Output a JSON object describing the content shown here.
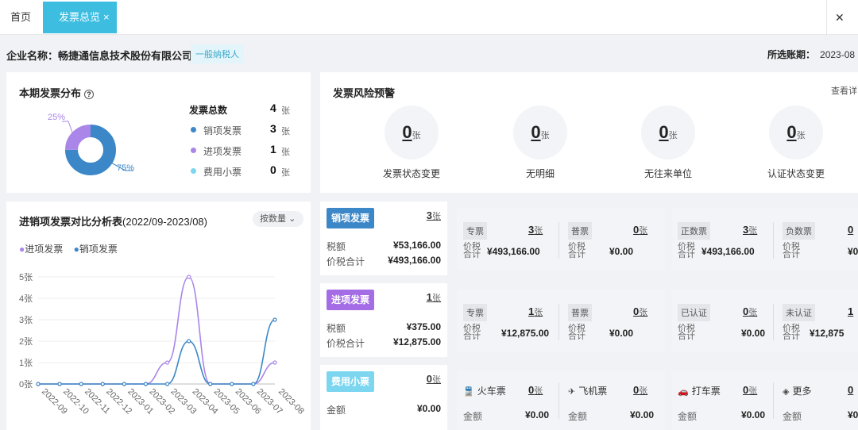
{
  "tabs": {
    "home": "首页",
    "active": "发票总览",
    "active_close": "×",
    "close_all": "✕"
  },
  "company": {
    "label": "企业名称：畅捷通信息技术股份有限公司",
    "tax_type": "一般纳税人"
  },
  "period": {
    "label": "所选账期：",
    "value": "2023-08"
  },
  "distribution": {
    "title": "本期发票分布",
    "help": "?",
    "pct_sales": "75%",
    "pct_purchase": "25%",
    "total_label": "发票总数",
    "total": "4",
    "unit": "张",
    "items": [
      {
        "label": "销项发票",
        "count": "3",
        "color": "#3c87c7"
      },
      {
        "label": "进项发票",
        "count": "1",
        "color": "#a986e8"
      },
      {
        "label": "费用小票",
        "count": "0",
        "color": "#7dd6f0"
      }
    ]
  },
  "risk": {
    "title": "发票风险预警",
    "link": "查看详",
    "unit": "张",
    "items": [
      {
        "label": "发票状态变更",
        "count": "0"
      },
      {
        "label": "无明细",
        "count": "0"
      },
      {
        "label": "无往来单位",
        "count": "0"
      },
      {
        "label": "认证状态变更",
        "count": "0"
      }
    ]
  },
  "compare": {
    "title": "进销项发票对比分析表",
    "range": "(2022/09-2023/08)",
    "sort_label": "按数量",
    "legend_purchase": "进项发票",
    "legend_sales": "销项发票"
  },
  "chart_data": {
    "type": "line",
    "x": [
      "2022-09",
      "2022-10",
      "2022-11",
      "2022-12",
      "2023-01",
      "2023-02",
      "2023-03",
      "2023-04",
      "2023-05",
      "2023-06",
      "2023-07",
      "2023-08"
    ],
    "ylim": [
      0,
      5
    ],
    "yticks": [
      "0张",
      "1张",
      "2张",
      "3张",
      "4张",
      "5张"
    ],
    "series": [
      {
        "name": "进项发票",
        "color": "#a986e8",
        "values": [
          0,
          0,
          0,
          0,
          0,
          0,
          1,
          5,
          0,
          0,
          0,
          1
        ]
      },
      {
        "name": "销项发票",
        "color": "#3c87c7",
        "values": [
          0,
          0,
          0,
          0,
          0,
          0,
          0,
          2,
          0,
          0,
          0,
          3
        ]
      }
    ]
  },
  "sales": {
    "badge": "销项发票",
    "count": "3",
    "unit": "张",
    "tax_label": "税额",
    "tax": "¥53,166.00",
    "total_label": "价税合计",
    "total": "¥493,166.00",
    "sub": [
      {
        "tag": "专票",
        "count": "3",
        "value": "¥493,166.00"
      },
      {
        "tag": "普票",
        "count": "0",
        "value": "¥0.00"
      },
      {
        "tag": "正数票",
        "count": "3",
        "value": "¥493,166.00"
      },
      {
        "tag": "负数票",
        "count": "0",
        "value": "¥0"
      }
    ]
  },
  "purchase": {
    "badge": "进项发票",
    "count": "1",
    "unit": "张",
    "tax_label": "税额",
    "tax": "¥375.00",
    "total_label": "价税合计",
    "total": "¥12,875.00",
    "sub": [
      {
        "tag": "专票",
        "count": "1",
        "value": "¥12,875.00"
      },
      {
        "tag": "普票",
        "count": "0",
        "value": "¥0.00"
      },
      {
        "tag": "已认证",
        "count": "0",
        "value": "¥0.00"
      },
      {
        "tag": "未认证",
        "count": "1",
        "value": "¥12,875"
      }
    ]
  },
  "expense": {
    "badge": "费用小票",
    "count": "0",
    "unit": "张",
    "amount_label": "金额",
    "amount": "¥0.00",
    "sub": [
      {
        "tag": "火车票",
        "icon": "train-icon",
        "glyph": "🚆",
        "count": "0",
        "value": "¥0.00"
      },
      {
        "tag": "飞机票",
        "icon": "plane-icon",
        "glyph": "✈",
        "count": "0",
        "value": "¥0.00"
      },
      {
        "tag": "打车票",
        "icon": "car-icon",
        "glyph": "🚗",
        "count": "0",
        "value": "¥0.00"
      },
      {
        "tag": "更多",
        "icon": "layers-icon",
        "glyph": "◈",
        "count": "0",
        "value": "¥0"
      }
    ]
  },
  "labels": {
    "price_tax": "价税合计",
    "amount": "金额"
  }
}
